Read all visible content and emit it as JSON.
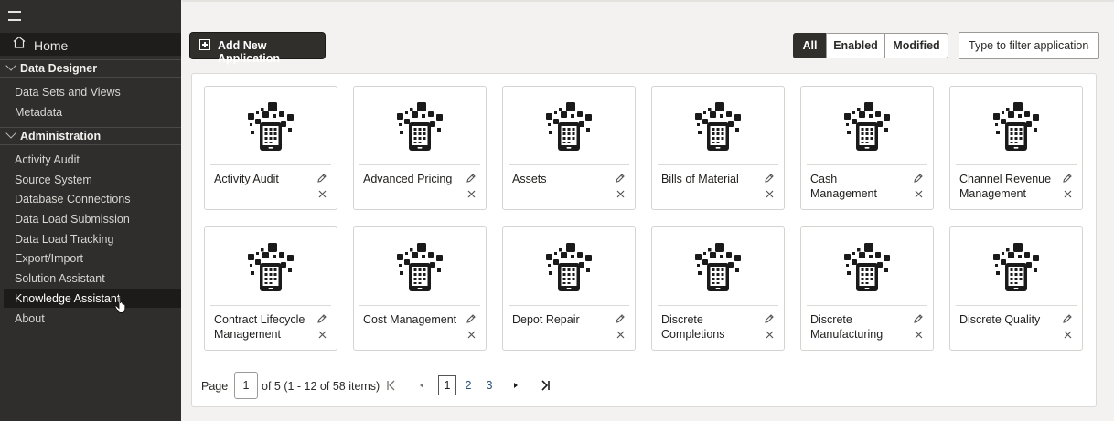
{
  "sidebar": {
    "home_label": "Home",
    "sections": [
      {
        "label": "Data Designer"
      },
      {
        "label": "Administration"
      }
    ],
    "items": [
      {
        "label": "Data Sets and Views"
      },
      {
        "label": "Metadata"
      },
      {
        "label": "Activity Audit"
      },
      {
        "label": "Source System"
      },
      {
        "label": "Database Connections"
      },
      {
        "label": "Data Load Submission"
      },
      {
        "label": "Data Load Tracking"
      },
      {
        "label": "Export/Import"
      },
      {
        "label": "Solution Assistant"
      },
      {
        "label": "Knowledge Assistant"
      },
      {
        "label": "About"
      }
    ],
    "active_item": "Knowledge Assistant"
  },
  "toolbar": {
    "add_label": "Add New Application",
    "filters": [
      {
        "label": "All"
      },
      {
        "label": "Enabled"
      },
      {
        "label": "Modified"
      }
    ],
    "active_filter": "All",
    "filter_placeholder": "Type to filter applications"
  },
  "applications": [
    {
      "name": "Activity Audit"
    },
    {
      "name": "Advanced Pricing"
    },
    {
      "name": "Assets"
    },
    {
      "name": "Bills of Material"
    },
    {
      "name": "Cash Management"
    },
    {
      "name": "Channel Revenue Management"
    },
    {
      "name": "Contract Lifecycle Management"
    },
    {
      "name": "Cost Management"
    },
    {
      "name": "Depot Repair"
    },
    {
      "name": "Discrete Completions"
    },
    {
      "name": "Discrete Manufacturing"
    },
    {
      "name": "Discrete Quality"
    }
  ],
  "pagination": {
    "page_label": "Page",
    "current_page": "1",
    "summary": "of 5 (1 - 12 of 58 items)",
    "pages": [
      "1",
      "2",
      "3"
    ]
  },
  "colors": {
    "sidebar_bg": "#2f2e2c",
    "active_bg": "#312f2c",
    "link": "#2b4e73"
  }
}
